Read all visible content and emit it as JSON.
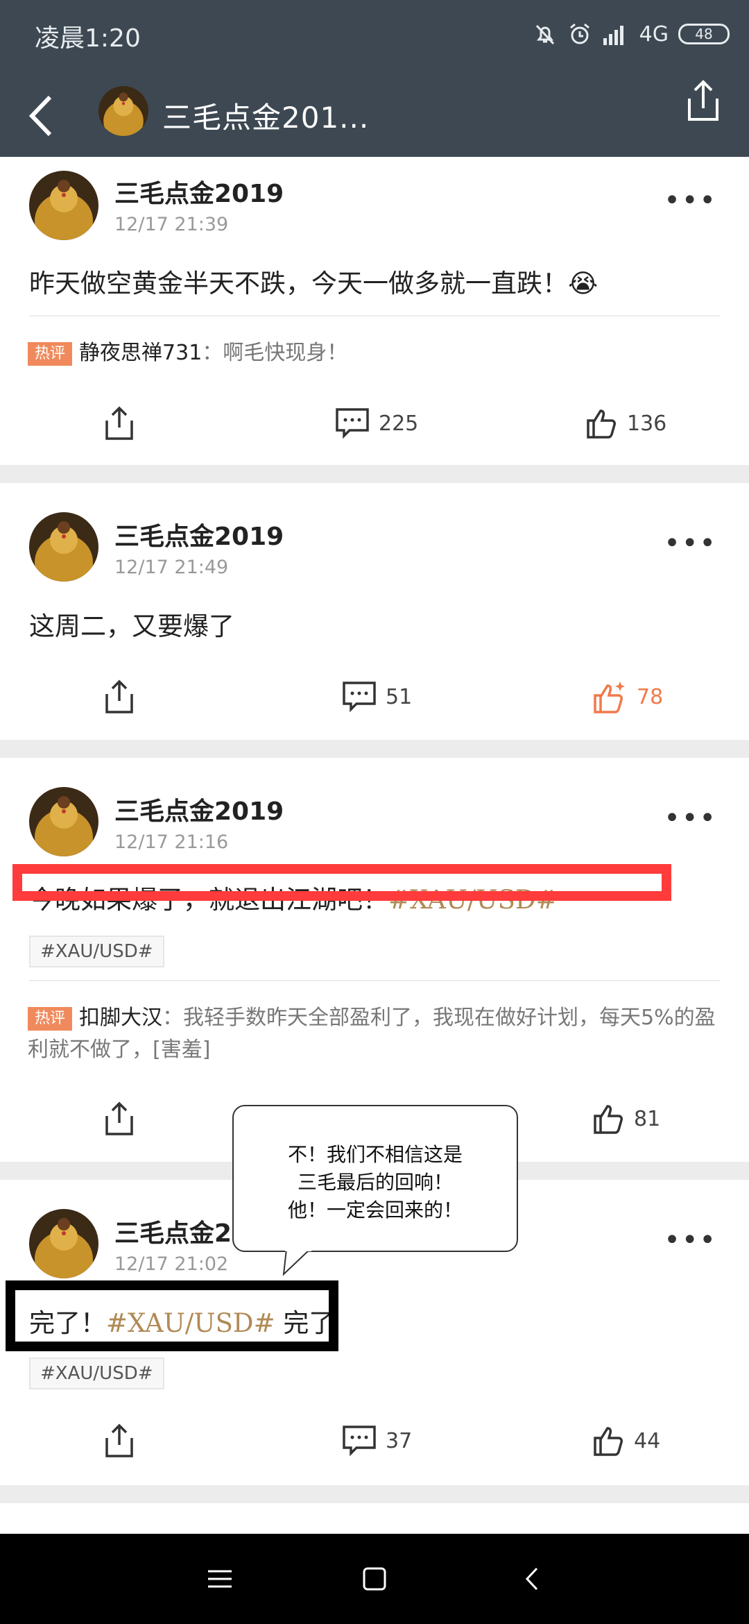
{
  "status_bar": {
    "time": "凌晨1:20",
    "network": "4G",
    "battery": "48"
  },
  "header": {
    "title": "三毛点金201..."
  },
  "posts": [
    {
      "username": "三毛点金2019",
      "time": "12/17 21:39",
      "text": "昨天做空黄金半天不跌，今天一做多就一直跌！",
      "emoji": "😭",
      "hot_badge": "热评",
      "hot_user": "静夜思禅731",
      "hot_text": "：啊毛快现身！",
      "comments": "225",
      "likes": "136"
    },
    {
      "username": "三毛点金2019",
      "time": "12/17 21:49",
      "text": "这周二，又要爆了",
      "comments": "51",
      "likes": "78"
    },
    {
      "username": "三毛点金2019",
      "time": "12/17 21:16",
      "text": "今晚如果爆了，就退出江湖吧！",
      "topic": "#XAU/USD#",
      "tag": "#XAU/USD#",
      "hot_badge": "热评",
      "hot_user": "扣脚大汉",
      "hot_text": "：我轻手数昨天全部盈利了，我现在做好计划，每天5%的盈利就不做了，[害羞]",
      "likes": "81"
    },
    {
      "username": "三毛点金2",
      "time": "12/17 21:02",
      "text_before": "完了！",
      "topic": "#XAU/USD#",
      "text_after": " 完了",
      "tag": "#XAU/USD#",
      "comments": "37",
      "likes": "44"
    }
  ],
  "bubble": {
    "line1": "不！我们不相信这是",
    "line2": "三毛最后的回响！",
    "line3": "他！一定会回来的！"
  }
}
